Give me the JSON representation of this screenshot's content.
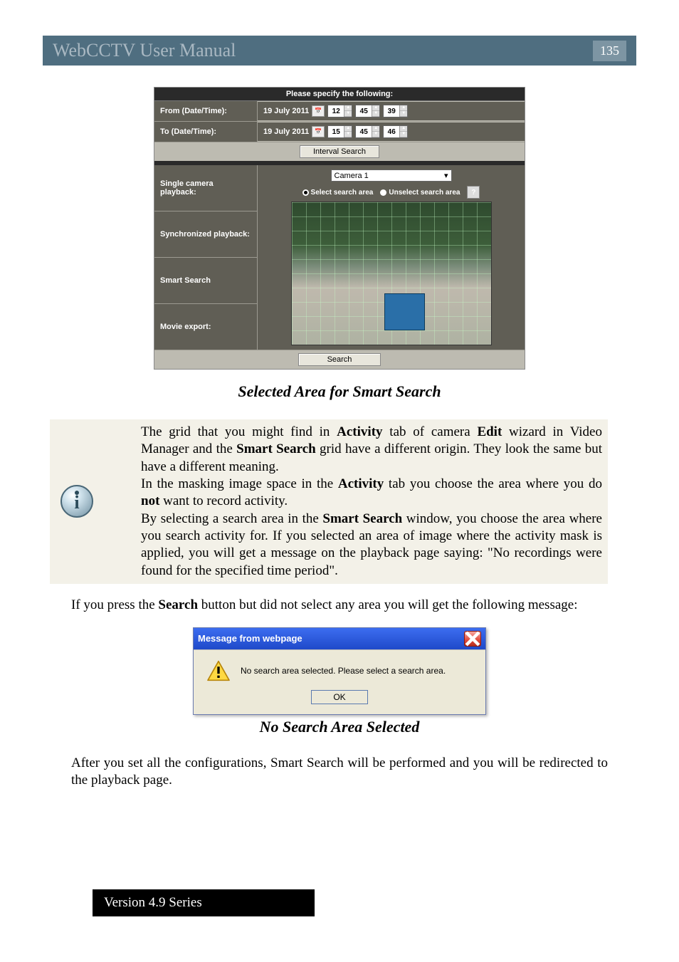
{
  "header": {
    "title": "WebCCTV User Manual",
    "page_number": "135"
  },
  "ui": {
    "title": "Please specify the following:",
    "from_label": "From (Date/Time):",
    "to_label": "To (Date/Time):",
    "from_date": "19 July 2011",
    "from_hh": "12",
    "from_mm": "45",
    "from_ss": "39",
    "to_date": "19 July 2011",
    "to_hh": "15",
    "to_mm": "45",
    "to_ss": "46",
    "interval_btn": "Interval Search",
    "single_label": "Single camera playback:",
    "sync_label": "Synchronized playback:",
    "smart_label": "Smart Search",
    "export_label": "Movie export:",
    "camera_selected": "Camera 1",
    "radio_select": "Select search area",
    "radio_unselect": "Unselect search area",
    "help_char": "?",
    "search_btn": "Search"
  },
  "caption1": "Selected Area for Smart Search",
  "info_para": "The grid that you might find in <b>Activity</b> tab of camera <b>Edit</b> wizard in Video Manager and the <b>Smart Search</b> grid have a different origin. They look the same but have a different meaning.<br>In the masking image space in the <b>Activity</b> tab you choose the area where you do <b>not</b> want to record activity.<br>By selecting a search area in the <b>Smart Search</b> window, you choose the area where you search activity for. If you selected an area of image where the activity mask is applied, you will get a message on the playback page saying: \"No recordings were found for the specified time period\".",
  "para2": "If you press the <b>Search</b> button but did not select any area you will get the following message:",
  "msgbox": {
    "title": "Message from webpage",
    "message": "No search area selected. Please select a search area.",
    "ok": "OK"
  },
  "caption2": "No Search Area Selected",
  "para3": "After you set all the configurations, Smart Search will be performed and you will be redirected to the playback page.",
  "footer": "Version 4.9 Series"
}
